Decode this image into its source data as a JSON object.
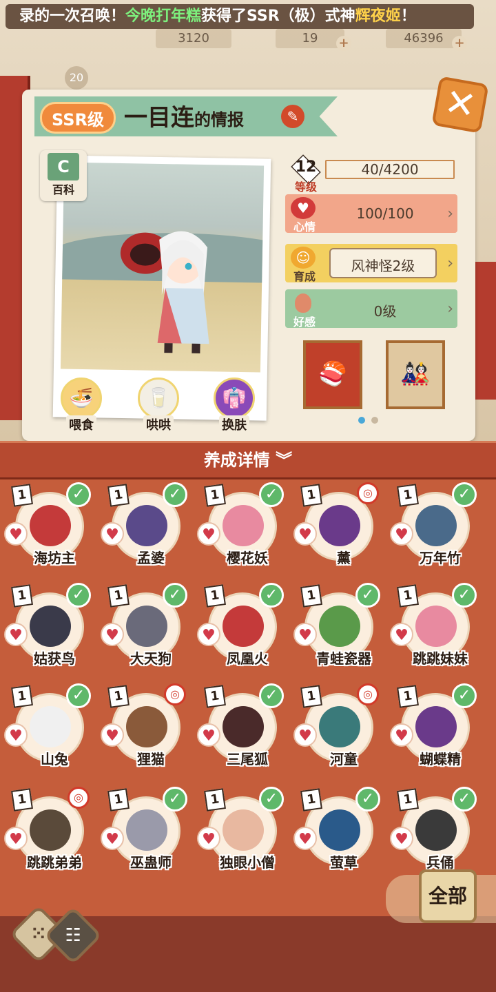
{
  "marquee": {
    "part1": "录的一次召唤！",
    "highlight1": "今晚打年糕",
    "part2": "获得了SSR（极）式神",
    "highlight2": "辉夜姬",
    "part3": "！"
  },
  "resources": {
    "r1": "3120",
    "r2": "19",
    "r3": "46396",
    "avatar_level": "20"
  },
  "shikigami": {
    "rarity": "SSR级",
    "name": "一目连",
    "name_suffix": "的情报",
    "encyclopedia_label": "百科",
    "actions": {
      "feed": "喂食",
      "coax": "哄哄",
      "skin": "换肤"
    }
  },
  "stats": {
    "level_label": "等级",
    "level_value": "12",
    "exp": "40/4200",
    "mood_label": "心情",
    "mood_value": "100/100",
    "nurture_label": "育成",
    "nurture_value": "风神怪2级",
    "affection_label": "好感",
    "affection_value": "0级"
  },
  "details_bar": {
    "label": "养成详情"
  },
  "cards": [
    {
      "name": "海坊主",
      "level": "1",
      "status": "check",
      "color": "#c43a3a"
    },
    {
      "name": "孟婆",
      "level": "1",
      "status": "check",
      "color": "#5a4a8a"
    },
    {
      "name": "樱花妖",
      "level": "1",
      "status": "check",
      "color": "#e88aa0"
    },
    {
      "name": "薰",
      "level": "1",
      "status": "circle",
      "color": "#6a3a8a"
    },
    {
      "name": "万年竹",
      "level": "1",
      "status": "check",
      "color": "#4a6a8a"
    },
    {
      "name": "姑获鸟",
      "level": "1",
      "status": "check",
      "color": "#3a3a4a"
    },
    {
      "name": "大天狗",
      "level": "1",
      "status": "check",
      "color": "#6a6a7a"
    },
    {
      "name": "凤凰火",
      "level": "1",
      "status": "check",
      "color": "#c43a3a"
    },
    {
      "name": "青蛙瓷器",
      "level": "1",
      "status": "check",
      "color": "#5a9a4a"
    },
    {
      "name": "跳跳妹妹",
      "level": "1",
      "status": "check",
      "color": "#e88aa0"
    },
    {
      "name": "山兔",
      "level": "1",
      "status": "check",
      "color": "#f0f0f0"
    },
    {
      "name": "狸猫",
      "level": "1",
      "status": "circle",
      "color": "#8a5a3a"
    },
    {
      "name": "三尾狐",
      "level": "1",
      "status": "check",
      "color": "#4a2a2a"
    },
    {
      "name": "河童",
      "level": "1",
      "status": "circle",
      "color": "#3a7a7a"
    },
    {
      "name": "蝴蝶精",
      "level": "1",
      "status": "check",
      "color": "#6a3a8a"
    },
    {
      "name": "跳跳弟弟",
      "level": "1",
      "status": "circle",
      "color": "#5a4a3a"
    },
    {
      "name": "巫蛊师",
      "level": "1",
      "status": "check",
      "color": "#9a9aaa"
    },
    {
      "name": "独眼小僧",
      "level": "1",
      "status": "check",
      "color": "#e8b8a0"
    },
    {
      "name": "萤草",
      "level": "1",
      "status": "check",
      "color": "#2a5a8a"
    },
    {
      "name": "兵俑",
      "level": "1",
      "status": "check",
      "color": "#3a3a3a"
    }
  ],
  "buttons": {
    "all": "全部"
  }
}
